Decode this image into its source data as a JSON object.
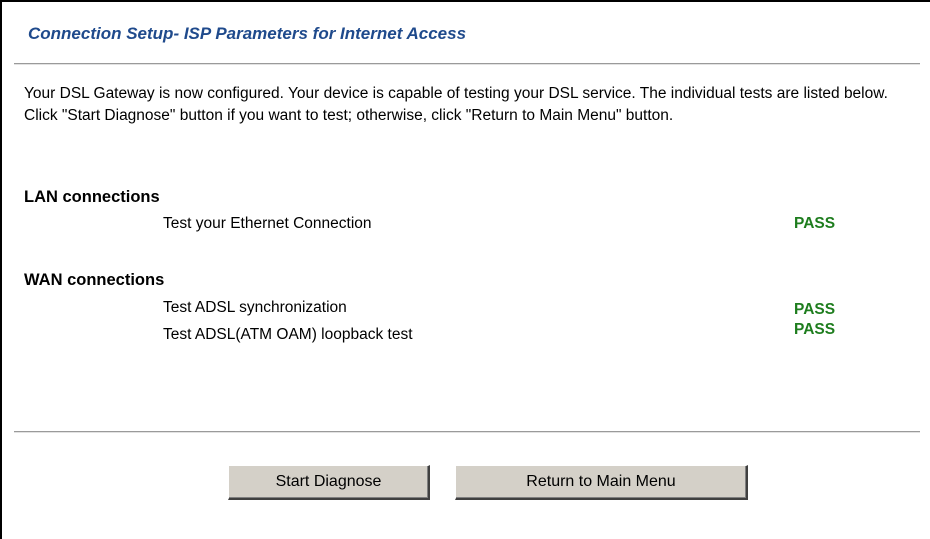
{
  "header": {
    "title": "Connection Setup- ISP Parameters for Internet Access"
  },
  "intro": {
    "text": "Your DSL Gateway is now configured. Your device is capable of testing your DSL service. The individual tests are listed below. Click \"Start Diagnose\" button if you want to test; otherwise, click \"Return to Main Menu\" button."
  },
  "lan": {
    "heading": "LAN connections",
    "tests": [
      {
        "label": "Test your Ethernet Connection",
        "result": "PASS"
      }
    ]
  },
  "wan": {
    "heading": "WAN connections",
    "tests": [
      {
        "label": "Test ADSL synchronization",
        "result": "PASS"
      },
      {
        "label": "Test ADSL(ATM OAM) loopback test",
        "result": "PASS"
      }
    ]
  },
  "buttons": {
    "start_diagnose": "Start Diagnose",
    "return_main": "Return to Main Menu"
  },
  "colors": {
    "title": "#1f4a8c",
    "pass": "#1e7d1e",
    "button_face": "#d4d0c8"
  }
}
